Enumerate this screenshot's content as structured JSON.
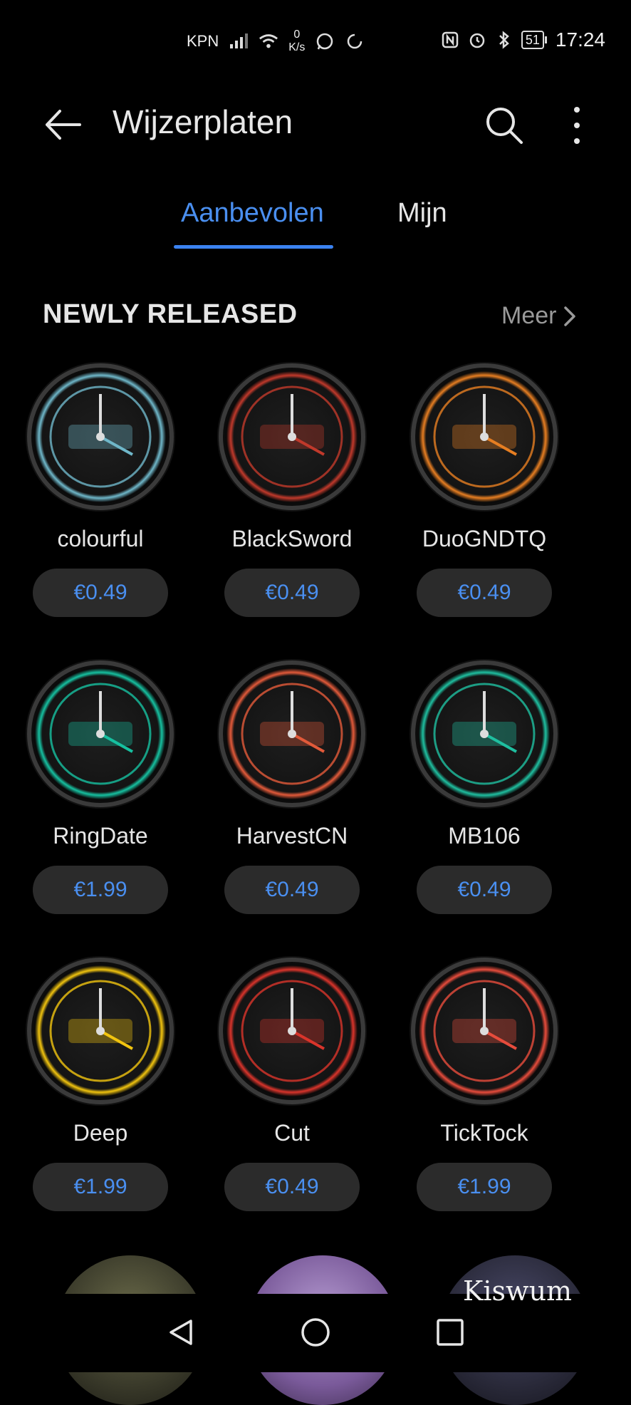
{
  "status_bar": {
    "carrier": "KPN",
    "net_speed_value": "0",
    "net_speed_unit": "K/s",
    "battery": "51",
    "time": "17:24"
  },
  "app_bar": {
    "title": "Wijzerplaten",
    "back_icon": "arrow-left-icon",
    "search_icon": "search-icon",
    "more_icon": "more-vertical-icon"
  },
  "tabs": [
    {
      "label": "Aanbevolen",
      "active": true
    },
    {
      "label": "Mijn",
      "active": false
    }
  ],
  "section": {
    "title": "NEWLY RELEASED",
    "more_label": "Meer"
  },
  "items": [
    {
      "name": "colourful",
      "price": "€0.49",
      "accent": "#6fb7c9"
    },
    {
      "name": "BlackSword",
      "price": "€0.49",
      "accent": "#c0392b"
    },
    {
      "name": "DuoGNDTQ",
      "price": "€0.49",
      "accent": "#e67e22"
    },
    {
      "name": "RingDate",
      "price": "€1.99",
      "accent": "#16c0a0"
    },
    {
      "name": "HarvestCN",
      "price": "€0.49",
      "accent": "#e25a3a"
    },
    {
      "name": "MB106",
      "price": "€0.49",
      "accent": "#1fbfa0"
    },
    {
      "name": "Deep",
      "price": "€1.99",
      "accent": "#f1c40f"
    },
    {
      "name": "Cut",
      "price": "€0.49",
      "accent": "#d9342b"
    },
    {
      "name": "TickTock",
      "price": "€1.99",
      "accent": "#e74c3c"
    }
  ],
  "watermark": "Kiswum",
  "nav": {
    "back_icon": "nav-back-icon",
    "home_icon": "nav-home-icon",
    "recents_icon": "nav-recents-icon"
  }
}
